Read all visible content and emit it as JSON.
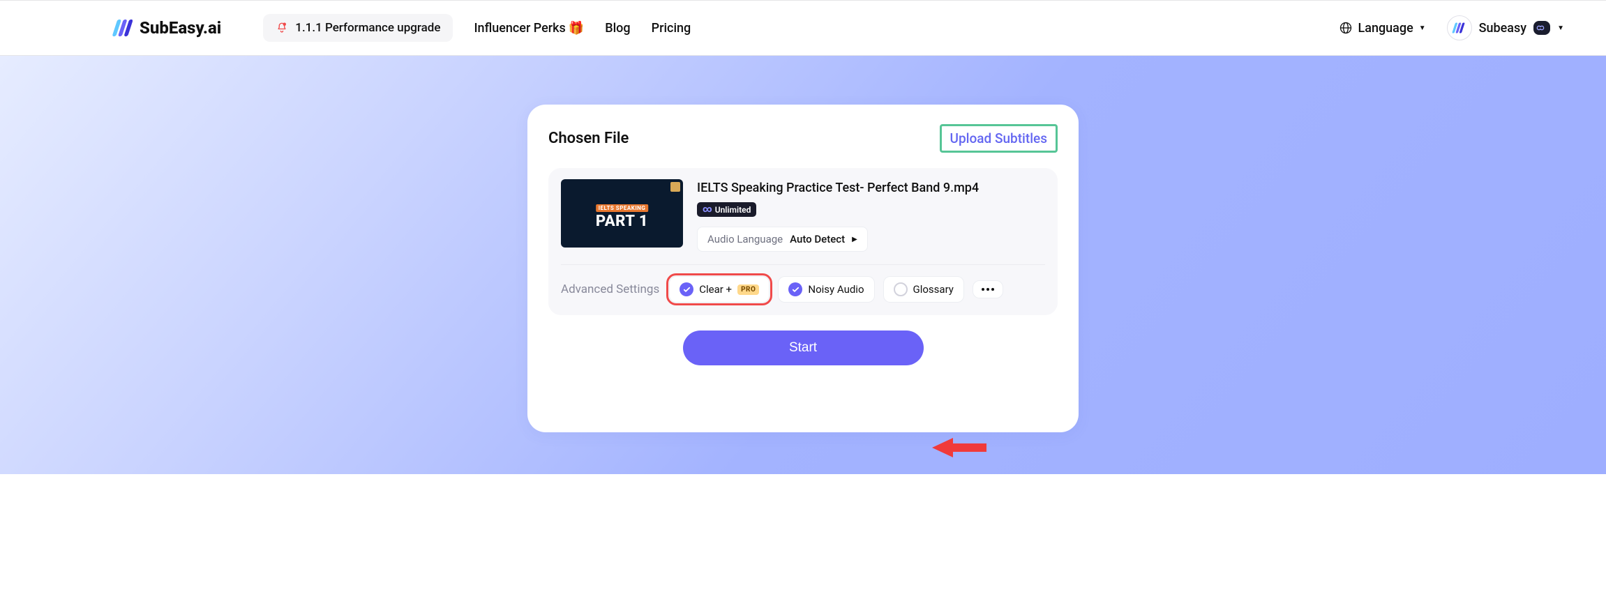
{
  "header": {
    "logo_text": "SubEasy.ai",
    "upgrade_text": "1.1.1 Performance upgrade",
    "nav": {
      "influencer": "Influencer Perks",
      "blog": "Blog",
      "pricing": "Pricing"
    },
    "language_label": "Language",
    "user_name": "Subeasy"
  },
  "card": {
    "title": "Chosen File",
    "upload_subtitles": "Upload Subtitles",
    "file": {
      "name": "IELTS Speaking Practice Test- Perfect Band 9.mp4",
      "plan_badge": "Unlimited",
      "thumb_tag": "IELTS SPEAKING",
      "thumb_part": "PART 1",
      "audio_lang_label": "Audio Language",
      "audio_lang_value": "Auto Detect"
    },
    "advanced_label": "Advanced Settings",
    "options": {
      "clear_plus": "Clear +",
      "pro_tag": "PRO",
      "noisy": "Noisy Audio",
      "glossary": "Glossary"
    },
    "start": "Start"
  }
}
